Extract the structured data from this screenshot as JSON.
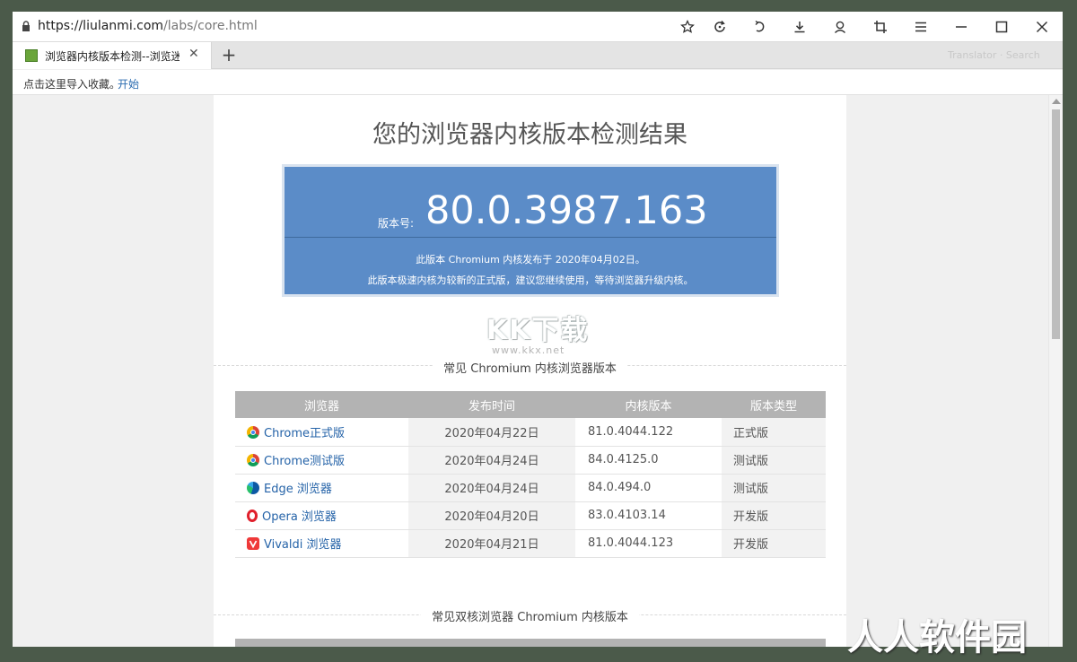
{
  "browser": {
    "url_domain": "https://liulanmi.com",
    "url_path": "/labs/core.html",
    "tab_title": "浏览器内核版本检测--浏览迷",
    "new_tab_label": "+",
    "tab_close_label": "✕",
    "faint_strip_text": "Translator · Search",
    "bookmark_hint": "点击这里导入收藏。",
    "bookmark_link": "开始",
    "toolbar_icons": [
      "star-icon",
      "refresh-icon",
      "undo-icon",
      "download-icon",
      "user-icon",
      "crop-icon",
      "menu-icon",
      "minimize-icon",
      "maximize-icon",
      "close-icon"
    ]
  },
  "page": {
    "title": "您的浏览器内核版本检测结果",
    "version_label": "版本号:",
    "version_number": "80.0.3987.163",
    "version_note1": "此版本 Chromium 内核发布于 2020年04月02日。",
    "version_note2": "此版本极速内核为较新的正式版，建议您继续使用，等待浏览器升级内核。",
    "watermark_big": "KK下载",
    "watermark_small": "www.kkx.net",
    "section1_title": "常见 Chromium 内核浏览器版本",
    "section2_title": "常见双核浏览器 Chromium 内核版本",
    "table_headers": [
      "浏览器",
      "发布时间",
      "内核版本",
      "版本类型"
    ],
    "rows": [
      {
        "browser": "Chrome正式版",
        "icon": "chrome-icon",
        "date": "2020年04月22日",
        "version": "81.0.4044.122",
        "type": "正式版",
        "highlight": true
      },
      {
        "browser": "Chrome测试版",
        "icon": "chrome-icon",
        "date": "2020年04月24日",
        "version": "84.0.4125.0",
        "type": "测试版",
        "highlight": false
      },
      {
        "browser": "Edge 浏览器",
        "icon": "edge-icon",
        "date": "2020年04月24日",
        "version": "84.0.494.0",
        "type": "测试版",
        "highlight": false
      },
      {
        "browser": "Opera 浏览器",
        "icon": "opera-icon",
        "date": "2020年04月20日",
        "version": "83.0.4103.14",
        "type": "开发版",
        "highlight": false
      },
      {
        "browser": "Vivaldi 浏览器",
        "icon": "vivaldi-icon",
        "date": "2020年04月21日",
        "version": "81.0.4044.123",
        "type": "开发版",
        "highlight": false
      }
    ]
  },
  "overlay": {
    "corner_watermark": "人人软件园"
  },
  "colors": {
    "version_box": "#5b8cc8",
    "table_header": "#b3b3b3",
    "link_blue": "#2563a8",
    "status_red": "#c0282d"
  }
}
